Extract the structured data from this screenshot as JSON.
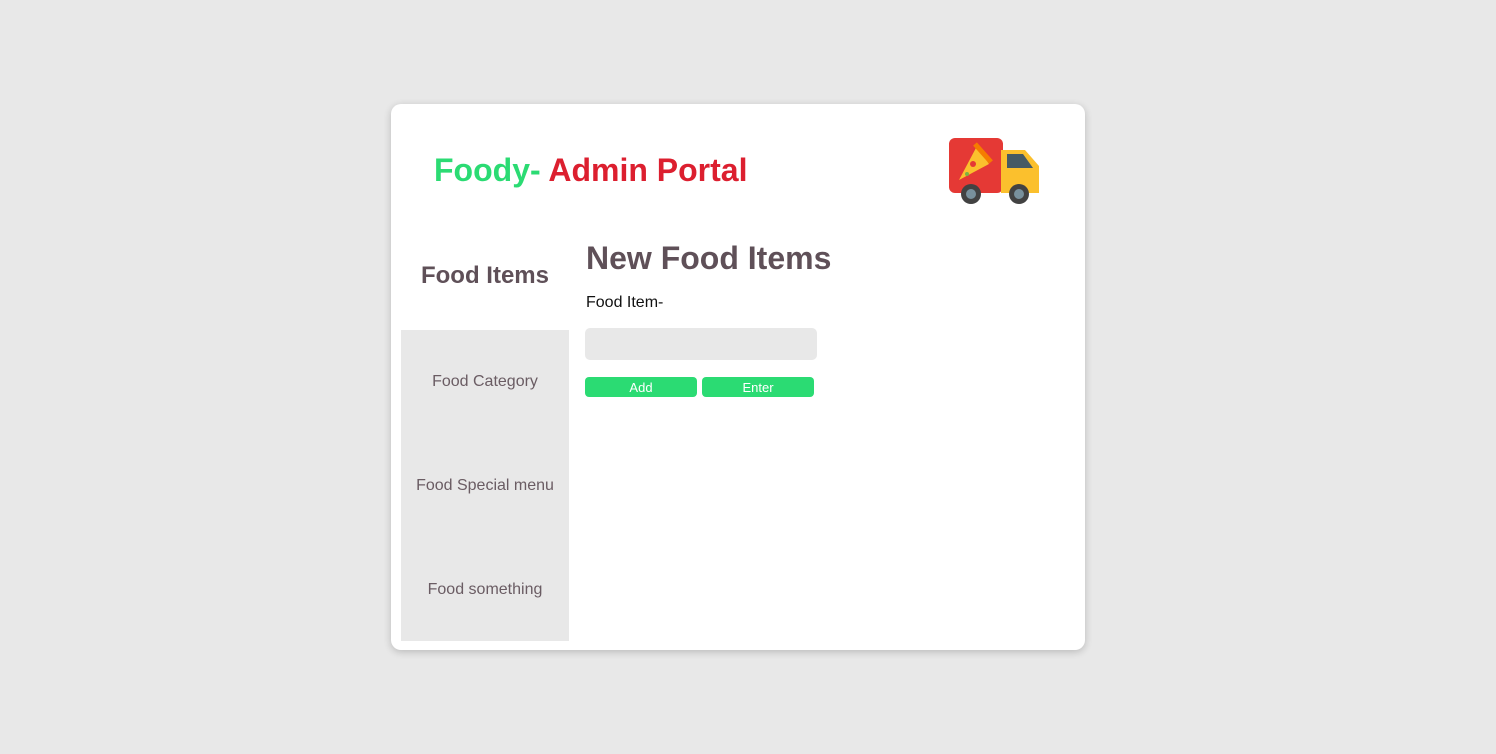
{
  "header": {
    "title_part1": "Foody-",
    "title_part2": " Admin Portal",
    "logo_icon": "pizza-delivery-truck-icon"
  },
  "sidebar": {
    "heading": "Food Items",
    "items": [
      {
        "label": "Food Category"
      },
      {
        "label": "Food Special menu"
      },
      {
        "label": "Food something"
      }
    ]
  },
  "main": {
    "heading": "New Food Items",
    "field_label": "Food Item-",
    "field_value": "",
    "add_label": "Add",
    "enter_label": "Enter"
  },
  "colors": {
    "green": "#2bdb73",
    "red": "#dc1f2f"
  }
}
